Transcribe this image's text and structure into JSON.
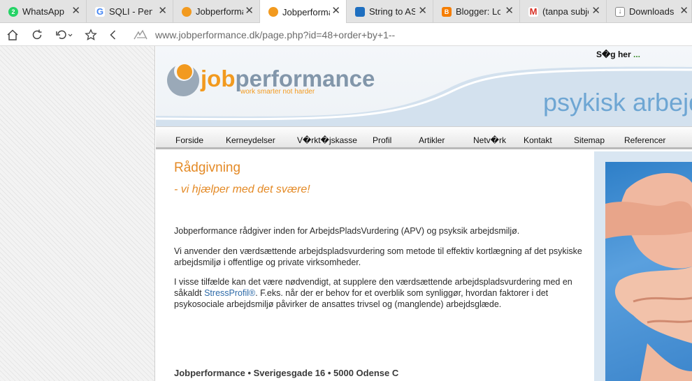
{
  "browser": {
    "tabs": [
      {
        "title": "WhatsApp",
        "favicon": "whatsapp-icon",
        "badge": "2",
        "color": "#25d366",
        "active": false
      },
      {
        "title": "SQLI - Penel",
        "favicon": "google-icon",
        "badge": "G",
        "color": "#4285f4",
        "active": false
      },
      {
        "title": "Jobperformance",
        "favicon": "jobperformance-icon",
        "badge": "",
        "color": "#f29a1f",
        "active": false
      },
      {
        "title": "Jobperformance",
        "favicon": "jobperformance-icon",
        "badge": "",
        "color": "#f29a1f",
        "active": true
      },
      {
        "title": "String to ASCII",
        "favicon": "converter-icon",
        "badge": "",
        "color": "#1e6fc0",
        "active": false
      },
      {
        "title": "Blogger: Lok",
        "favicon": "blogger-icon",
        "badge": "B",
        "color": "#f57d00",
        "active": false
      },
      {
        "title": "(tanpa subjek)",
        "favicon": "gmail-icon",
        "badge": "M",
        "color": "#d93025",
        "active": false
      },
      {
        "title": "Downloads",
        "favicon": "download-icon",
        "badge": "↓",
        "color": "#666666",
        "active": false
      }
    ],
    "url": "www.jobperformance.dk/page.php?id=48+order+by+1--"
  },
  "site": {
    "logo": {
      "part1": "job",
      "part2": "performance",
      "tagline": "work smarter not harder"
    },
    "search_label": "S�g her",
    "search_dots": "...",
    "banner_phrase": "psykisk arbejd",
    "nav": [
      "Forside",
      "Kerneydelser",
      "V�rkt�jskasse",
      "Profil",
      "Artikler",
      "Netv�rk",
      "Kontakt",
      "Sitemap",
      "Referencer"
    ],
    "heading": "Rådgivning",
    "subheading": "- vi hjælper med det svære!",
    "paragraphs": {
      "p1": "Jobperformance rådgiver inden for ArbejdsPladsVurdering (APV) og psyksik arbejdsmiljø.",
      "p2": "Vi anvender den værdsættende arbejdspladsvurdering som metode til effektiv kortlægning af det psykiske arbejdsmiljø i offentlige og private virksomheder.",
      "p3_before": "I visse tilfælde kan det være nødvendigt, at supplere den værdsættende arbejdspladsvurdering med en såkaldt ",
      "p3_link": "StressProfil®",
      "p3_after": ". F.eks. når der er behov for et overblik som synliggør, hvordan faktorer i det psykosociale arbejdsmiljø påvirker de ansattes trivsel og (manglende) arbejdsglæde."
    },
    "address": "Jobperformance • Sverigesgade 16 • 5000 Odense C",
    "accent_color": "#e48a26"
  }
}
